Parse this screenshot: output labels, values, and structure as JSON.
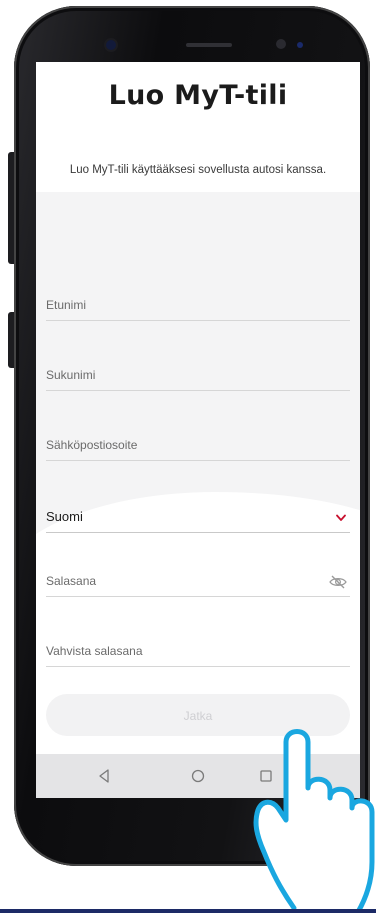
{
  "screen": {
    "title": "Luo MyT-tili",
    "subtitle": "Luo MyT-tili käyttääksesi sovellusta autosi kanssa."
  },
  "form": {
    "first_name_label": "Etunimi",
    "last_name_label": "Sukunimi",
    "email_label": "Sähköpostiosoite",
    "country_value": "Suomi",
    "password_label": "Salasana",
    "confirm_password_label": "Vahvista salasana",
    "continue_label": "Jatka"
  },
  "icons": {
    "dropdown": "chevron-down-icon",
    "password_visibility": "eye-slash-icon",
    "nav_back": "triangle-back-icon",
    "nav_home": "circle-home-icon",
    "nav_recent": "square-recent-icon",
    "pointer": "hand-pointer-icon"
  },
  "colors": {
    "accent": "#c8102e",
    "hand_outline": "#1aa7e0",
    "bottom_bar": "#1c2a66",
    "button_bg": "#f2f2f3"
  }
}
